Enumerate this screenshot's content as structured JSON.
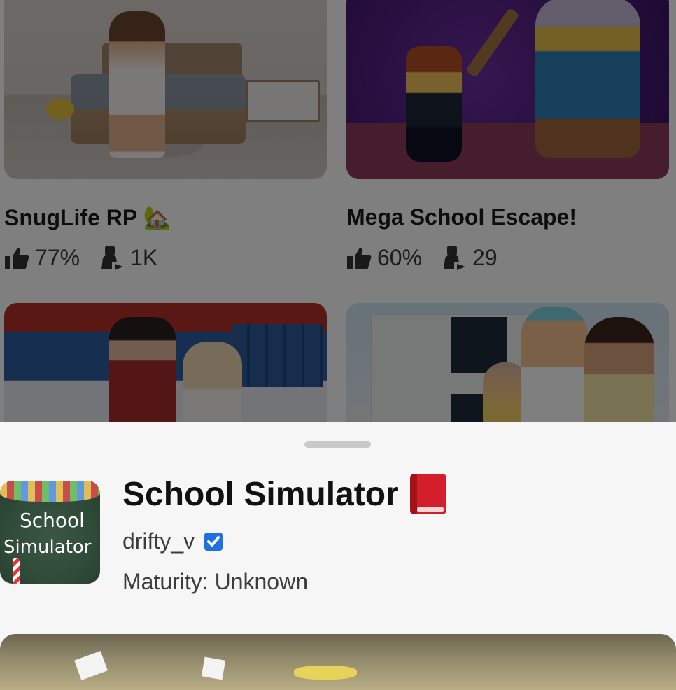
{
  "games": [
    {
      "title": "SnugLife RP 🏡",
      "rating": "77%",
      "players": "1K"
    },
    {
      "title": "Mega School Escape!",
      "rating": "60%",
      "players": "29"
    },
    {
      "title": "",
      "rating": "",
      "players": ""
    },
    {
      "title": "",
      "rating": "",
      "players": ""
    }
  ],
  "sheet": {
    "title": "School Simulator",
    "creator": "drifty_v",
    "maturity": "Maturity: Unknown",
    "icon_text_line1": "School",
    "icon_text_line2": "Simulator"
  },
  "icons": {
    "like": "thumbs-up-icon",
    "players": "players-icon",
    "verified": "verified-badge-icon",
    "title_emoji": "red-book-icon"
  },
  "colors": {
    "verified_blue": "#1f6fe5",
    "sheet_bg": "#f6f6f7"
  }
}
